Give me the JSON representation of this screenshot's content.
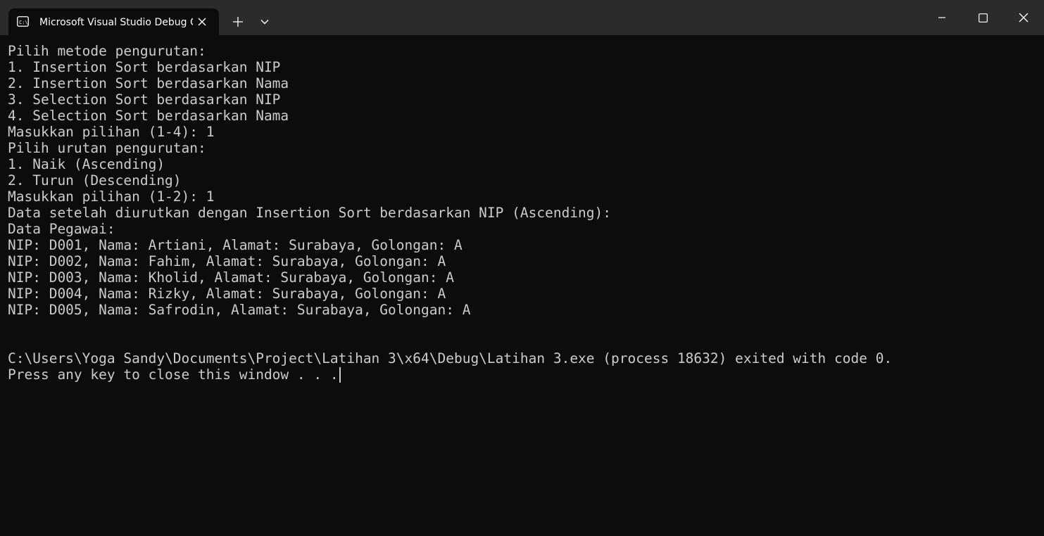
{
  "window": {
    "tab_title": "Microsoft Visual Studio Debug Console",
    "tab_icon": "terminal-icon",
    "buttons": {
      "close_tab": "close-icon",
      "new_tab": "plus-icon",
      "dropdown": "chevron-down-icon",
      "minimize": "minimize-icon",
      "maximize": "maximize-icon",
      "close_window": "close-icon"
    }
  },
  "terminal": {
    "lines": [
      "Pilih metode pengurutan:",
      "1. Insertion Sort berdasarkan NIP",
      "2. Insertion Sort berdasarkan Nama",
      "3. Selection Sort berdasarkan NIP",
      "4. Selection Sort berdasarkan Nama",
      "Masukkan pilihan (1-4): 1",
      "Pilih urutan pengurutan:",
      "1. Naik (Ascending)",
      "2. Turun (Descending)",
      "Masukkan pilihan (1-2): 1",
      "Data setelah diurutkan dengan Insertion Sort berdasarkan NIP (Ascending):",
      "Data Pegawai:",
      "NIP: D001, Nama: Artiani, Alamat: Surabaya, Golongan: A",
      "NIP: D002, Nama: Fahim, Alamat: Surabaya, Golongan: A",
      "NIP: D003, Nama: Kholid, Alamat: Surabaya, Golongan: A",
      "NIP: D004, Nama: Rizky, Alamat: Surabaya, Golongan: A",
      "NIP: D005, Nama: Safrodin, Alamat: Surabaya, Golongan: A",
      "",
      "",
      "C:\\Users\\Yoga Sandy\\Documents\\Project\\Latihan 3\\x64\\Debug\\Latihan 3.exe (process 18632) exited with code 0.",
      "Press any key to close this window . . ."
    ]
  },
  "colors": {
    "background": "#0c0c0c",
    "titlebar": "#2b2b2b",
    "text": "#cccccc"
  }
}
